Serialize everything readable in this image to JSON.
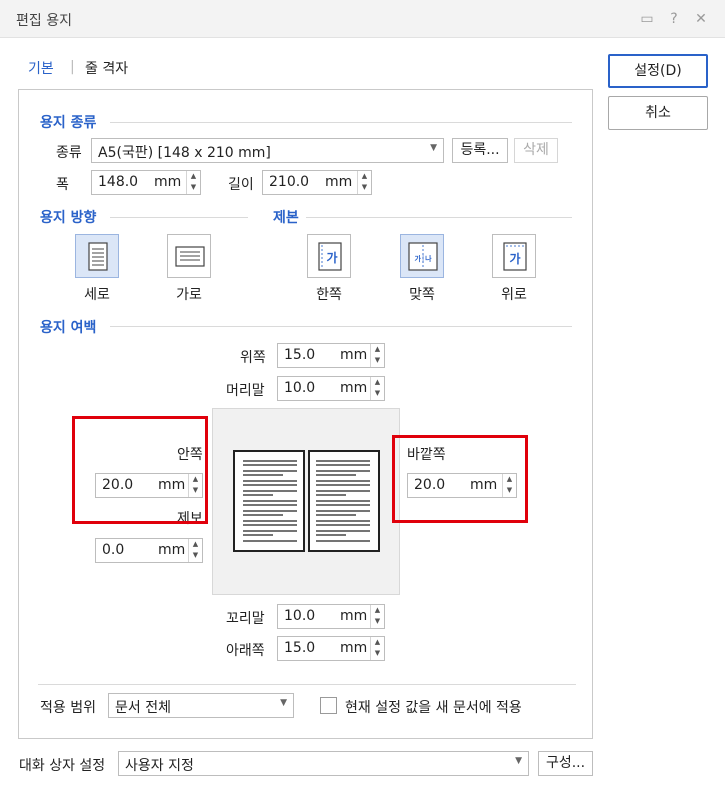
{
  "window": {
    "title": "편집 용지"
  },
  "titlebar_icons": [
    "comment-icon",
    "help-icon",
    "close-icon"
  ],
  "titlebar_glyphs": {
    "comment": "▭",
    "help": "?",
    "close": "✕"
  },
  "tabs": [
    {
      "label": "기본",
      "active": true
    },
    {
      "label": "줄 격자",
      "active": false
    }
  ],
  "tab_separator": "|",
  "buttons": {
    "set": "설정(D)",
    "cancel": "취소"
  },
  "paper_type": {
    "section_title": "용지 종류",
    "type_label": "종류",
    "type_value": "A5(국판)  [148 x 210 mm]",
    "register_button": "등록...",
    "delete_button": "삭제",
    "width_label": "폭",
    "width_value": "148.0",
    "height_label": "길이",
    "height_value": "210.0",
    "unit": "mm"
  },
  "orientation": {
    "section_title": "용지 방향",
    "portrait": "세로",
    "landscape": "가로",
    "selected": "세로"
  },
  "binding": {
    "section_title": "제본",
    "single": "한쪽",
    "facing": "맞쪽",
    "top": "위로",
    "selected": "맞쪽",
    "glyph_single": "가",
    "glyph_facing": "가│나",
    "glyph_top": "가"
  },
  "margins": {
    "section_title": "용지 여백",
    "top_label": "위쪽",
    "top_value": "15.0",
    "header_label": "머리말",
    "header_value": "10.0",
    "inside_label": "안쪽",
    "inside_value": "20.0",
    "gutter_label": "제보",
    "gutter_value": "0.0",
    "outside_label": "바깥쪽",
    "outside_value": "20.0",
    "footer_label": "꼬리말",
    "footer_value": "10.0",
    "bottom_label": "아래쪽",
    "bottom_value": "15.0",
    "unit": "mm"
  },
  "apply": {
    "scope_label": "적용 범위",
    "scope_value": "문서 전체",
    "checkbox_label": "현재 설정 값을 새 문서에 적용",
    "checked": false
  },
  "dialog_settings": {
    "label": "대화 상자 설정",
    "value": "사용자 지정",
    "configure_button": "구성..."
  },
  "colors": {
    "accent": "#2a62c9",
    "highlight_box": "#e0000b"
  }
}
